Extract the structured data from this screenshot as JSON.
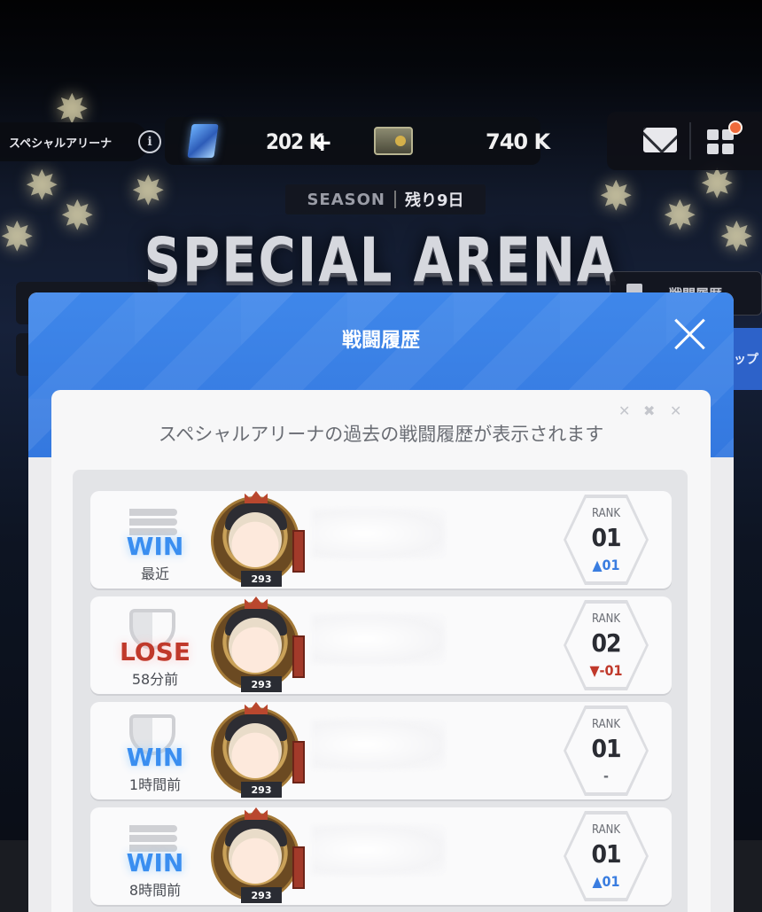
{
  "header": {
    "arena_label": "スペシャルアリーナ",
    "info_icon": "info-icon",
    "gem_value": "202 K",
    "gem_plus": "+",
    "ticket_value": "740 K"
  },
  "season": {
    "label": "SEASON",
    "remaining": "残り9日"
  },
  "arena_title": "SPECIAL ARENA",
  "history_button": {
    "label": "戦闘履歴"
  },
  "side_button_partial": "ップ",
  "modal": {
    "title": "戦闘履歴",
    "description": "スペシャルアリーナの過去の戦闘履歴が表示されます",
    "entries": [
      {
        "result": "WIN",
        "time": "最近",
        "level": "293",
        "rank_label": "RANK",
        "rank": "01",
        "change": "▲01",
        "change_dir": "up",
        "icon": "bullets-icon"
      },
      {
        "result": "LOSE",
        "time": "58分前",
        "level": "293",
        "rank_label": "RANK",
        "rank": "02",
        "change": "▼-01",
        "change_dir": "down",
        "icon": "shield-icon"
      },
      {
        "result": "WIN",
        "time": "1時間前",
        "level": "293",
        "rank_label": "RANK",
        "rank": "01",
        "change": "-",
        "change_dir": "flat",
        "icon": "shield-icon"
      },
      {
        "result": "WIN",
        "time": "8時間前",
        "level": "293",
        "rank_label": "RANK",
        "rank": "01",
        "change": "▲01",
        "change_dir": "up",
        "icon": "bullets-icon"
      }
    ]
  },
  "colors": {
    "win": "#3a8ef0",
    "lose": "#c0392b",
    "modal_header": "#3a80e6",
    "rank_up": "#3a7de0",
    "rank_down": "#c0392b"
  }
}
